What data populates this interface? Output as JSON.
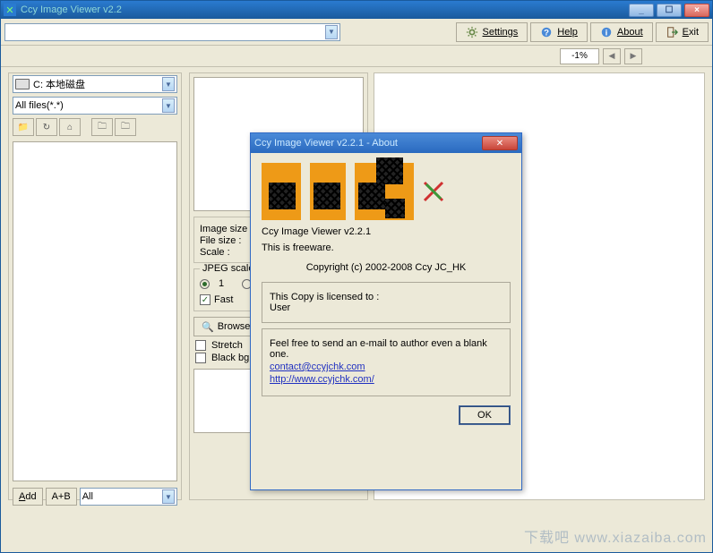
{
  "window": {
    "title": "Ccy Image Viewer v2.2",
    "controls": {
      "min": "_",
      "max": "☐",
      "close": "×"
    }
  },
  "toolbar": {
    "path_value": "",
    "settings": "Settings",
    "help": "Help",
    "about": "About",
    "exit": "Exit"
  },
  "zoom": {
    "percent": "-1%"
  },
  "left": {
    "drive": "C: 本地磁盘",
    "filter": "All files(*.*)",
    "add": "Add",
    "add_b": "A+B",
    "all": "All"
  },
  "center": {
    "image_size": "Image size :",
    "file_size": "File size :",
    "scale": "Scale :",
    "jpeg_legend": "JPEG scale",
    "jpeg_opt1": "1",
    "fast": "Fast",
    "browse": "Browse",
    "stretch": "Stretch",
    "blackbg": "Black bg"
  },
  "about": {
    "title": "Ccy Image Viewer v2.2.1 - About",
    "product": "Ccy Image Viewer v2.2.1",
    "freeware": "This is freeware.",
    "copyright": "Copyright (c) 2002-2008 Ccy JC_HK",
    "licensed_to_label": "This Copy is licensed to :",
    "licensed_to_value": "User",
    "email_prompt": "Feel free to send an e-mail to author even a blank one.",
    "email": "contact@ccyjchk.com",
    "url": "http://www.ccyjchk.com/",
    "ok": "OK"
  },
  "watermark": "下载吧 www.xiazaiba.com"
}
